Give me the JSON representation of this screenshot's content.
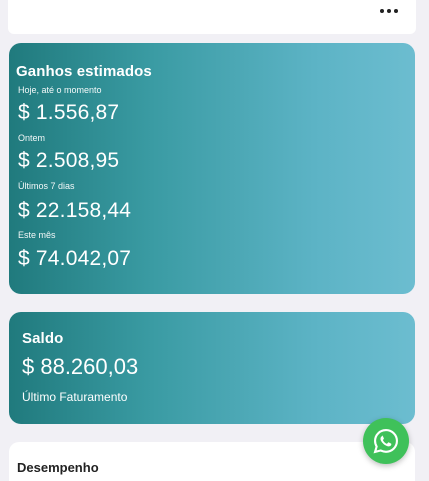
{
  "earnings": {
    "title": "Ganhos estimados",
    "rows": [
      {
        "label": "Hoje, até o momento",
        "value": "$ 1.556,87"
      },
      {
        "label": "Ontem",
        "value": "$ 2.508,95"
      },
      {
        "label": "Últimos 7 dias",
        "value": "$ 22.158,44"
      },
      {
        "label": "Este mês",
        "value": "$ 74.042,07"
      }
    ]
  },
  "balance": {
    "title": "Saldo",
    "value": "$ 88.260,03",
    "subtitle": "Último Faturamento"
  },
  "performance": {
    "title": "Desempenho"
  },
  "icons": {
    "menu": "more-horizontal-icon",
    "fab": "whatsapp-icon"
  },
  "colors": {
    "card_start": "#207a7d",
    "card_end": "#6cbdd0",
    "fab": "#3fc15a"
  }
}
